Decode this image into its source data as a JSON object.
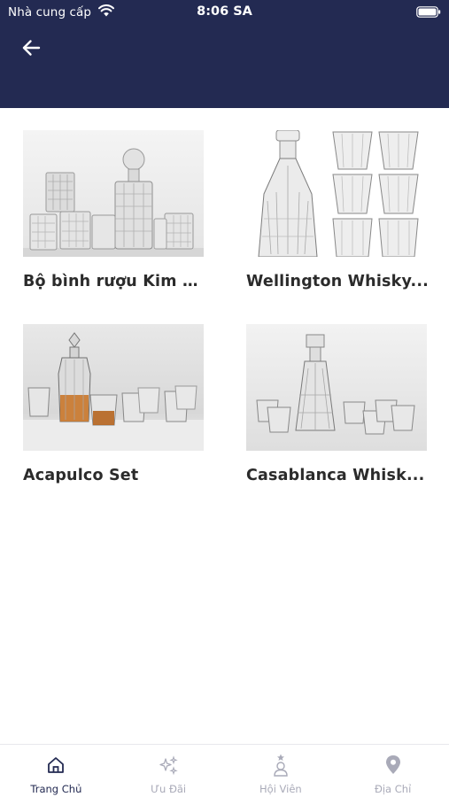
{
  "status_bar": {
    "carrier": "Nhà cung cấp",
    "time": "8:06 SA"
  },
  "header": {
    "back_icon": "arrow-left-icon",
    "background": "#232a52"
  },
  "products": [
    {
      "name": "Bộ bình rượu Kim C...",
      "image": "crystal-decanter-set-image"
    },
    {
      "name": "Wellington Whisky...",
      "image": "wellington-decanter-glasses-image"
    },
    {
      "name": "Acapulco Set",
      "image": "acapulco-set-image"
    },
    {
      "name": "Casablanca Whisk...",
      "image": "casablanca-decanter-set-image"
    }
  ],
  "tabbar": {
    "tabs": [
      {
        "label": "Trang Chủ",
        "icon": "home-icon",
        "active": true
      },
      {
        "label": "Ưu Đãi",
        "icon": "sparkles-icon",
        "active": false
      },
      {
        "label": "Hội Viên",
        "icon": "member-star-icon",
        "active": false
      },
      {
        "label": "Địa Chỉ",
        "icon": "location-pin-icon",
        "active": false
      }
    ],
    "active_color": "#232a52",
    "inactive_color": "#a9aab8"
  }
}
